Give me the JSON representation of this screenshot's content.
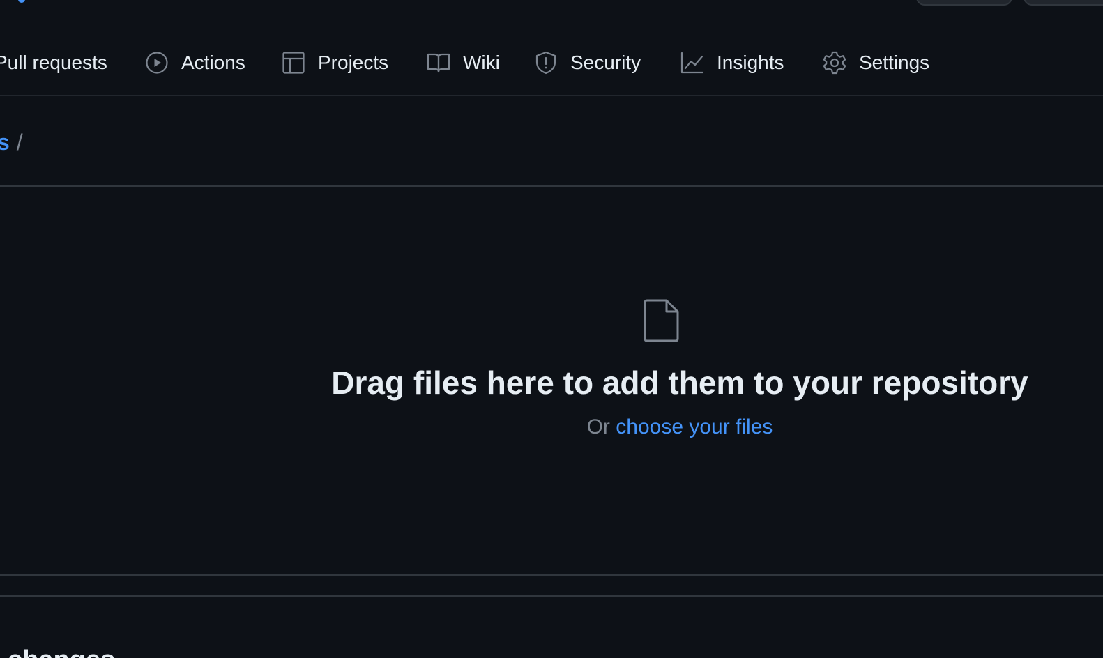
{
  "nav": {
    "items": [
      {
        "label": "Pull requests",
        "icon": "pull-request-icon"
      },
      {
        "label": "Actions",
        "icon": "play-circle-icon"
      },
      {
        "label": "Projects",
        "icon": "table-icon"
      },
      {
        "label": "Wiki",
        "icon": "book-icon"
      },
      {
        "label": "Security",
        "icon": "shield-icon"
      },
      {
        "label": "Insights",
        "icon": "graph-icon"
      },
      {
        "label": "Settings",
        "icon": "gear-icon"
      }
    ]
  },
  "breadcrumb": {
    "repo_fragment": "s",
    "separator": "/"
  },
  "dropzone": {
    "icon": "file-icon",
    "title": "Drag files here to add them to your repository",
    "or_text": "Or",
    "choose_link": "choose your files"
  },
  "commit": {
    "heading": "nit changes"
  },
  "colors": {
    "background": "#0d1117",
    "link": "#4493f8",
    "text": "#e6edf3",
    "muted": "#7d8590",
    "border": "#30363d"
  }
}
